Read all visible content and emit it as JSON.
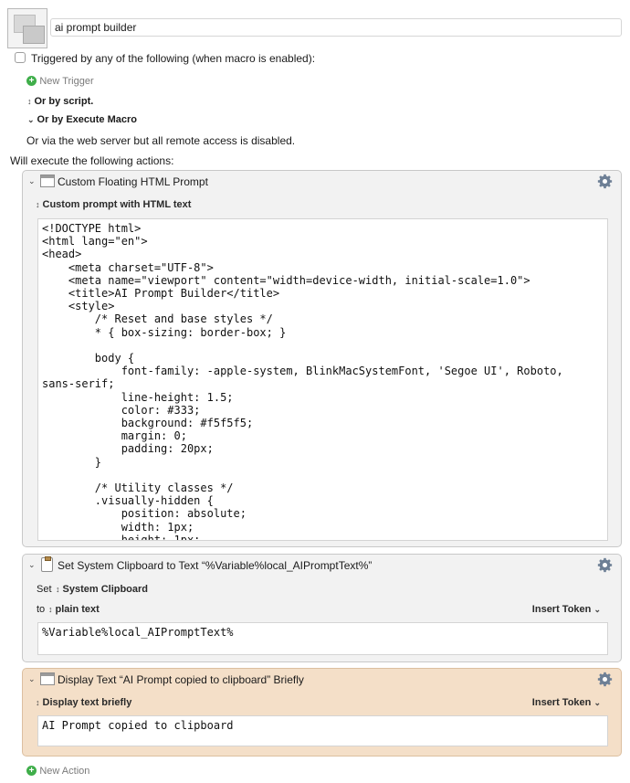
{
  "macro": {
    "name": "ai prompt builder",
    "trigger_label": "Triggered by any of the following (when macro is enabled):",
    "new_trigger": "New Trigger",
    "or_by_script": "Or by script.",
    "or_by_execute_macro": "Or by Execute Macro",
    "web_server_note": "Or via the web server but all remote access is disabled.",
    "will_execute": "Will execute the following actions:",
    "new_action": "New Action"
  },
  "actions": [
    {
      "title": "Custom Floating HTML Prompt",
      "mode": "Custom prompt with HTML text",
      "code": "<!DOCTYPE html>\n<html lang=\"en\">\n<head>\n    <meta charset=\"UTF-8\">\n    <meta name=\"viewport\" content=\"width=device-width, initial-scale=1.0\">\n    <title>AI Prompt Builder</title>\n    <style>\n        /* Reset and base styles */\n        * { box-sizing: border-box; }\n\n        body {\n            font-family: -apple-system, BlinkMacSystemFont, 'Segoe UI', Roboto,\nsans-serif;\n            line-height: 1.5;\n            color: #333;\n            background: #f5f5f5;\n            margin: 0;\n            padding: 20px;\n        }\n\n        /* Utility classes */\n        .visually-hidden {\n            position: absolute;\n            width: 1px;\n            height: 1px;"
    },
    {
      "title": "Set System Clipboard to Text “%Variable%local_AIPromptText%”",
      "set_label": "Set",
      "clipboard": "System Clipboard",
      "to_label": "to",
      "format": "plain text",
      "insert_token": "Insert Token",
      "value": "%Variable%local_AIPromptText%"
    },
    {
      "title": "Display Text “AI Prompt copied to clipboard” Briefly",
      "mode": "Display text briefly",
      "insert_token": "Insert Token",
      "value": "AI Prompt copied to clipboard"
    }
  ],
  "colors": {
    "highlight_action": "#f4dfc8",
    "action_bg": "#f2f2f2",
    "add_green": "#3fae4a"
  }
}
